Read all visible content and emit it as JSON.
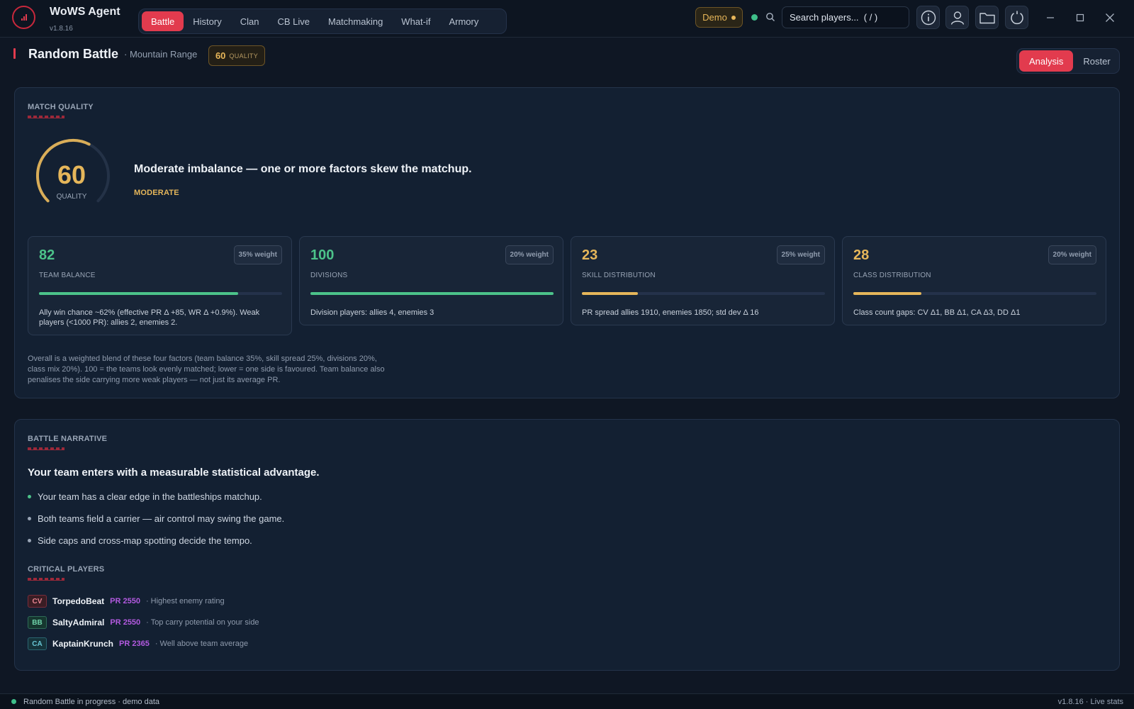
{
  "app": {
    "name": "WoWS Agent",
    "version": "v1.8.16"
  },
  "nav": {
    "tabs": [
      {
        "label": "Battle",
        "active": true
      },
      {
        "label": "History"
      },
      {
        "label": "Clan"
      },
      {
        "label": "CB Live"
      },
      {
        "label": "Matchmaking"
      },
      {
        "label": "What-if"
      },
      {
        "label": "Armory"
      }
    ]
  },
  "header": {
    "demo_label": "Demo",
    "search_placeholder": "Search players...  ( / )",
    "icons": [
      "info-icon",
      "user-icon",
      "folder-icon",
      "power-icon"
    ],
    "window_controls": [
      "minimize-icon",
      "maximize-icon",
      "close-icon"
    ]
  },
  "page": {
    "title": "Random Battle",
    "subtitle": "· Mountain Range",
    "quality_value": "60",
    "quality_label": "QUALITY",
    "view_toggle": [
      {
        "label": "Analysis",
        "active": true
      },
      {
        "label": "Roster"
      }
    ]
  },
  "match_quality": {
    "section_title": "MATCH QUALITY",
    "score": "60",
    "score_fraction": 0.6,
    "score_label": "QUALITY",
    "headline": "Moderate imbalance — one or more factors skew the matchup.",
    "level": "MODERATE",
    "factors": [
      {
        "score": "82",
        "fill": 0.82,
        "weight": "35% weight",
        "label": "TEAM BALANCE",
        "color": "#4cc38a",
        "desc": "Ally win chance ~62% (effective PR Δ +85, WR Δ +0.9%). Weak players (<1000 PR): allies 2, enemies 2."
      },
      {
        "score": "100",
        "fill": 1.0,
        "weight": "20% weight",
        "label": "DIVISIONS",
        "color": "#4cc38a",
        "desc": "Division players: allies 4, enemies 3"
      },
      {
        "score": "23",
        "fill": 0.23,
        "weight": "25% weight",
        "label": "SKILL DISTRIBUTION",
        "color": "#e5b65a",
        "desc": "PR spread allies 1910, enemies 1850; std dev Δ 16"
      },
      {
        "score": "28",
        "fill": 0.28,
        "weight": "20% weight",
        "label": "CLASS DISTRIBUTION",
        "color": "#e5b65a",
        "desc": "Class count gaps: CV Δ1, BB Δ1, CA Δ3, DD Δ1"
      }
    ],
    "note": "Overall is a weighted blend of these four factors (team balance 35%, skill spread 25%, divisions 20%, class mix 20%). 100 = the teams look evenly matched; lower = one side is favoured. Team balance also penalises the side carrying more weak players — not just its average PR."
  },
  "narrative": {
    "section_title": "BATTLE NARRATIVE",
    "headline": "Your team enters with a measurable statistical advantage.",
    "points": [
      {
        "text": "Your team has a clear edge in the battleships matchup.",
        "color": "#4cc38a"
      },
      {
        "text": "Both teams field a carrier — air control may swing the game.",
        "color": "#9aa6b7"
      },
      {
        "text": "Side caps and cross-map spotting decide the tempo.",
        "color": "#9aa6b7"
      }
    ],
    "critical_title": "CRITICAL PLAYERS",
    "critical_players": [
      {
        "class": "CV",
        "name": "TorpedoBeat",
        "pr": "PR 2550",
        "note": "· Highest enemy rating"
      },
      {
        "class": "BB",
        "name": "SaltyAdmiral",
        "pr": "PR 2550",
        "note": "· Top carry potential on your side"
      },
      {
        "class": "CA",
        "name": "KaptainKrunch",
        "pr": "PR 2365",
        "note": "· Well above team average"
      }
    ]
  },
  "statusbar": {
    "left": "Random Battle in progress · demo data",
    "version": "v1.8.16",
    "sep": "·",
    "right": "Live stats"
  },
  "colors": {
    "accent": "#e23b4e",
    "good": "#4cc38a",
    "warn": "#e5b65a",
    "pr": "#b35ae0"
  }
}
